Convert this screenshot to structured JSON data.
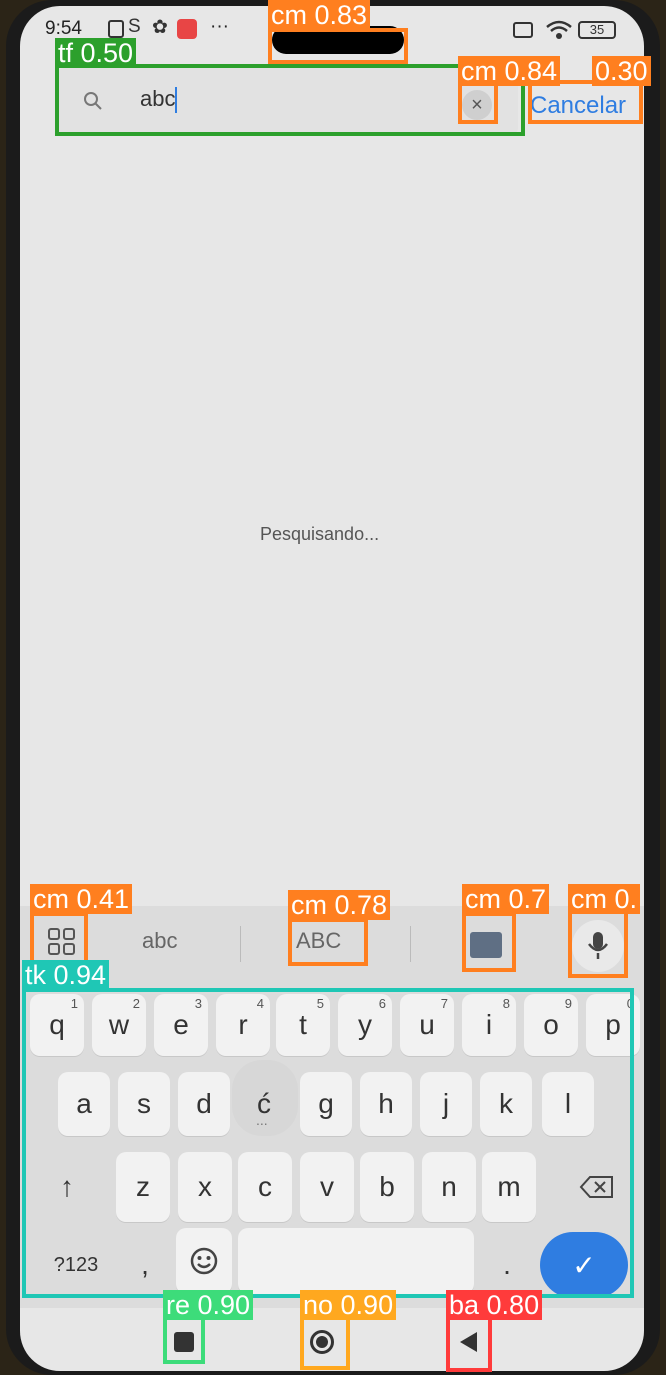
{
  "status_bar": {
    "time": "9:54",
    "more": "···",
    "battery": "35"
  },
  "search": {
    "value": "abc",
    "cancel_label": "Cancelar",
    "clear_symbol": "×"
  },
  "main": {
    "loading_text": "Pesquisando..."
  },
  "keyboard": {
    "suggestions": [
      "abc",
      "ABC"
    ],
    "row1": [
      {
        "key": "q",
        "hint": "1"
      },
      {
        "key": "w",
        "hint": "2"
      },
      {
        "key": "e",
        "hint": "3"
      },
      {
        "key": "r",
        "hint": "4"
      },
      {
        "key": "t",
        "hint": "5"
      },
      {
        "key": "y",
        "hint": "6"
      },
      {
        "key": "u",
        "hint": "7"
      },
      {
        "key": "i",
        "hint": "8"
      },
      {
        "key": "o",
        "hint": "9"
      },
      {
        "key": "p",
        "hint": "0"
      }
    ],
    "row2": [
      "a",
      "s",
      "d",
      "ć",
      "g",
      "h",
      "j",
      "k",
      "l"
    ],
    "row3": [
      "z",
      "x",
      "c",
      "v",
      "b",
      "n",
      "m"
    ],
    "shift_symbol": "↑",
    "popup_dots": "...",
    "numbers_label": "?123",
    "comma": ",",
    "period": ".",
    "enter_symbol": "✓"
  },
  "detections": [
    {
      "label": "cm 0.83",
      "color": "#ff7f1f"
    },
    {
      "label": "tf 0.50",
      "color": "#2ca02c"
    },
    {
      "label": "cm 0.84",
      "color": "#ff7f1f"
    },
    {
      "label": "0.30",
      "color": "#ff7f1f"
    },
    {
      "label": "cm 0.41",
      "color": "#ff7f1f"
    },
    {
      "label": "cm 0.78",
      "color": "#ff7f1f"
    },
    {
      "label": "cm 0.7",
      "color": "#ff7f1f"
    },
    {
      "label": "cm 0.",
      "color": "#ff7f1f"
    },
    {
      "label": "tk 0.94",
      "color": "#1fc7b5"
    },
    {
      "label": "re 0.90",
      "color": "#3ddc7a"
    },
    {
      "label": "no 0.90",
      "color": "#ffa81f"
    },
    {
      "label": "ba 0.80",
      "color": "#ff3b3b"
    }
  ],
  "colors": {
    "accent": "#2f7de1",
    "screen_bg": "#e7e7e7"
  }
}
